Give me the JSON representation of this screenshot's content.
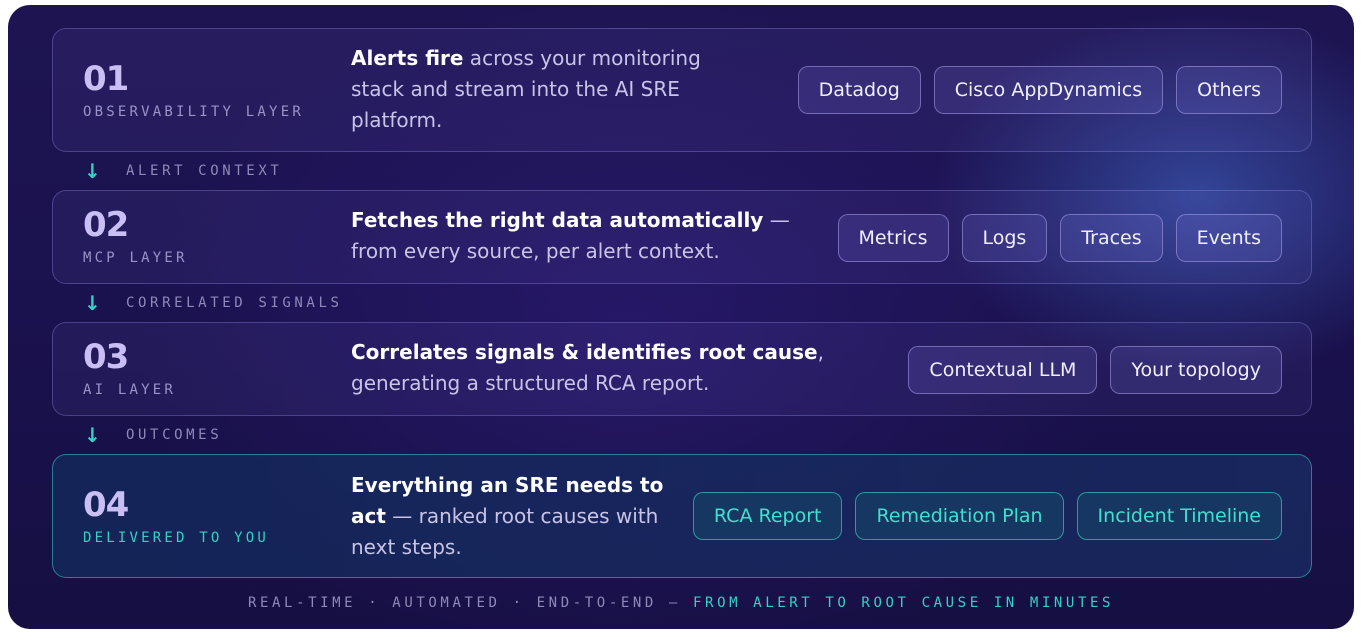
{
  "layers": [
    {
      "number": "01",
      "label": "OBSERVABILITY LAYER",
      "desc_bold": "Alerts fire",
      "desc_rest": " across your monitoring stack and stream into the AI SRE platform.",
      "chips": [
        "Datadog",
        "Cisco AppDynamics",
        "Others"
      ]
    },
    {
      "number": "02",
      "label": "MCP LAYER",
      "desc_bold": "Fetches the right data automatically",
      "desc_rest": " — from every source, per alert context.",
      "chips": [
        "Metrics",
        "Logs",
        "Traces",
        "Events"
      ]
    },
    {
      "number": "03",
      "label": "AI LAYER",
      "desc_bold": "Correlates signals & identifies root cause",
      "desc_rest": ", generating a structured RCA report.",
      "chips": [
        "Contextual LLM",
        "Your topology"
      ]
    },
    {
      "number": "04",
      "label": "DELIVERED TO YOU",
      "desc_bold": "Everything an SRE needs to act",
      "desc_rest": " — ranked root causes with next steps.",
      "chips": [
        "RCA Report",
        "Remediation Plan",
        "Incident Timeline"
      ]
    }
  ],
  "connectors": [
    {
      "arrow": "↓",
      "label": "ALERT CONTEXT"
    },
    {
      "arrow": "↓",
      "label": "CORRELATED SIGNALS"
    },
    {
      "arrow": "↓",
      "label": "OUTCOMES"
    }
  ],
  "footer": {
    "muted": "REAL-TIME · AUTOMATED · END-TO-END —",
    "accent": "FROM ALERT TO ROOT CAUSE IN MINUTES"
  },
  "colors": {
    "accent_teal": "#34d1c4",
    "background": "#1b1250",
    "chip_text": "#f0eefc"
  }
}
